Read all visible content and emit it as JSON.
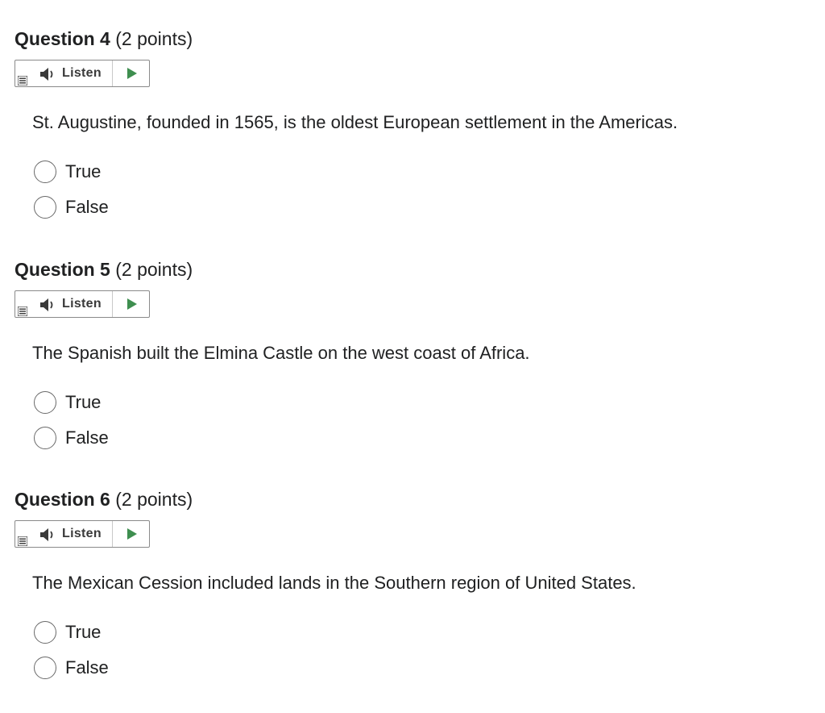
{
  "questions": [
    {
      "number_label": "Question 4",
      "points_label": "(2 points)",
      "listen_label": "Listen",
      "text": "St. Augustine, founded in 1565, is the oldest European settlement in the Americas.",
      "options": [
        "True",
        "False"
      ]
    },
    {
      "number_label": "Question 5",
      "points_label": "(2 points)",
      "listen_label": "Listen",
      "text": "The Spanish built the Elmina Castle on the west coast of Africa.",
      "options": [
        "True",
        "False"
      ]
    },
    {
      "number_label": "Question 6",
      "points_label": "(2 points)",
      "listen_label": "Listen",
      "text": "The Mexican Cession included lands in the Southern region of United States.",
      "options": [
        "True",
        "False"
      ]
    }
  ],
  "icons": {
    "menu": "menu-icon",
    "speaker": "speaker-icon",
    "play": "play-icon"
  },
  "colors": {
    "play_green": "#3e8e4f",
    "text": "#202122"
  }
}
